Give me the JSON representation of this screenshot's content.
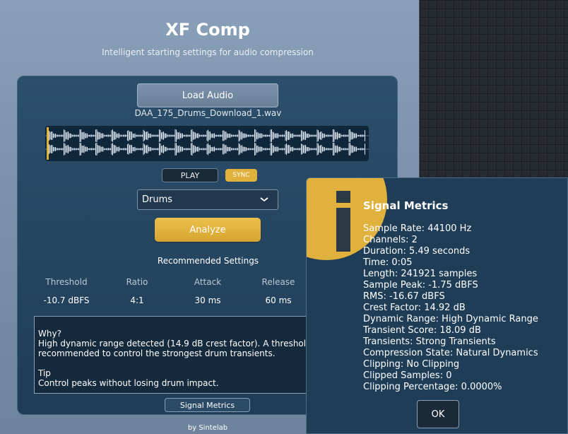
{
  "app": {
    "title": "XF Comp",
    "subtitle": "Intelligent starting settings for audio compression",
    "credit": "by Sintelab"
  },
  "controls": {
    "load_label": "Load Audio",
    "file_name": "DAA_175_Drums_Download_1.wav",
    "play_label": "PLAY",
    "sync_label": "SYNC",
    "preset_value": "Drums",
    "analyze_label": "Analyze",
    "metrics_label": "Signal Metrics"
  },
  "settings": {
    "title": "Recommended Settings",
    "columns": [
      {
        "header": "Threshold",
        "value": "-10.7 dBFS"
      },
      {
        "header": "Ratio",
        "value": "4:1"
      },
      {
        "header": "Attack",
        "value": "30 ms"
      },
      {
        "header": "Release",
        "value": "60 ms"
      }
    ]
  },
  "why": {
    "heading": "Why?",
    "line1": "High dynamic range detected (14.9 dB crest factor). A threshold of",
    "line2": "recommended to control the strongest drum transients.",
    "tip_heading": "Tip",
    "tip_text": "Control peaks without losing drum impact."
  },
  "dialog": {
    "title": "Signal Metrics",
    "ok_label": "OK",
    "metrics": [
      "Sample Rate: 44100 Hz",
      "Channels: 2",
      "Duration: 5.49 seconds",
      "Time: 0:05",
      "Length: 241921 samples",
      "Sample Peak: -1.75 dBFS",
      "RMS: -16.67 dBFS",
      "Crest Factor: 14.92 dB",
      "Dynamic Range: High Dynamic Range",
      "Transient Score: 18.09 dB",
      "Transients: Strong Transients",
      "Compression State: Natural Dynamics",
      "Clipping: No Clipping",
      "Clipped Samples: 0",
      "Clipping Percentage: 0.0000%"
    ]
  },
  "colors": {
    "accent": "#e0b13c",
    "panel": "#1f3c56",
    "window": "#7d93ab"
  },
  "icons": [
    "chevron-down-icon",
    "info-icon"
  ]
}
